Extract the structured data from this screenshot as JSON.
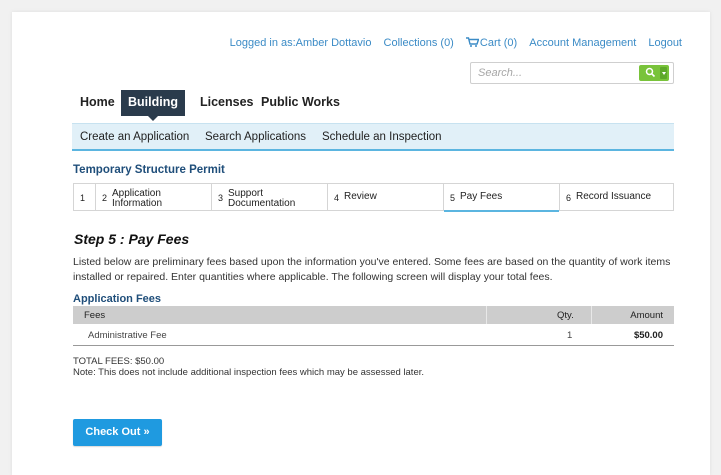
{
  "header": {
    "logged_in": "Logged in as:Amber Dottavio",
    "collections": "Collections (0)",
    "cart": "Cart (0)",
    "account": "Account Management",
    "logout": "Logout",
    "search_placeholder": "Search...",
    "link_color": "#3b8bc6"
  },
  "main_nav": {
    "items": [
      "Home",
      "Building",
      "Licenses",
      "Public Works"
    ],
    "active": "Building"
  },
  "sub_nav": {
    "items": [
      "Create an Application",
      "Search Applications",
      "Schedule an Inspection"
    ]
  },
  "permit_title": "Temporary Structure Permit",
  "steps": [
    {
      "num": "1",
      "label": ""
    },
    {
      "num": "2",
      "label": "Application Information"
    },
    {
      "num": "3",
      "label": "Support Documentation"
    },
    {
      "num": "4",
      "label": "Review"
    },
    {
      "num": "5",
      "label": "Pay Fees",
      "active": true
    },
    {
      "num": "6",
      "label": "Record Issuance"
    }
  ],
  "step_heading": "Step 5 : Pay Fees",
  "intro": "Listed below are preliminary fees based upon the information you've entered. Some fees are based on the quantity of work items installed or repaired. Enter quantities where applicable. The following screen will display your total fees.",
  "fees": {
    "section_title": "Application Fees",
    "columns": [
      "Fees",
      "Qty.",
      "Amount"
    ],
    "rows": [
      {
        "fee": "Administrative Fee",
        "qty": "1",
        "amount": "$50.00"
      }
    ],
    "total": "TOTAL FEES: $50.00",
    "note": "Note: This does not include additional inspection fees which may be assessed later."
  },
  "checkout_label": "Check Out »",
  "accent": {
    "nav_dark": "#2a3b4c",
    "subnav_bg": "#e1f0f8",
    "search_green": "#79c33a",
    "button_blue": "#1f9ae0"
  }
}
